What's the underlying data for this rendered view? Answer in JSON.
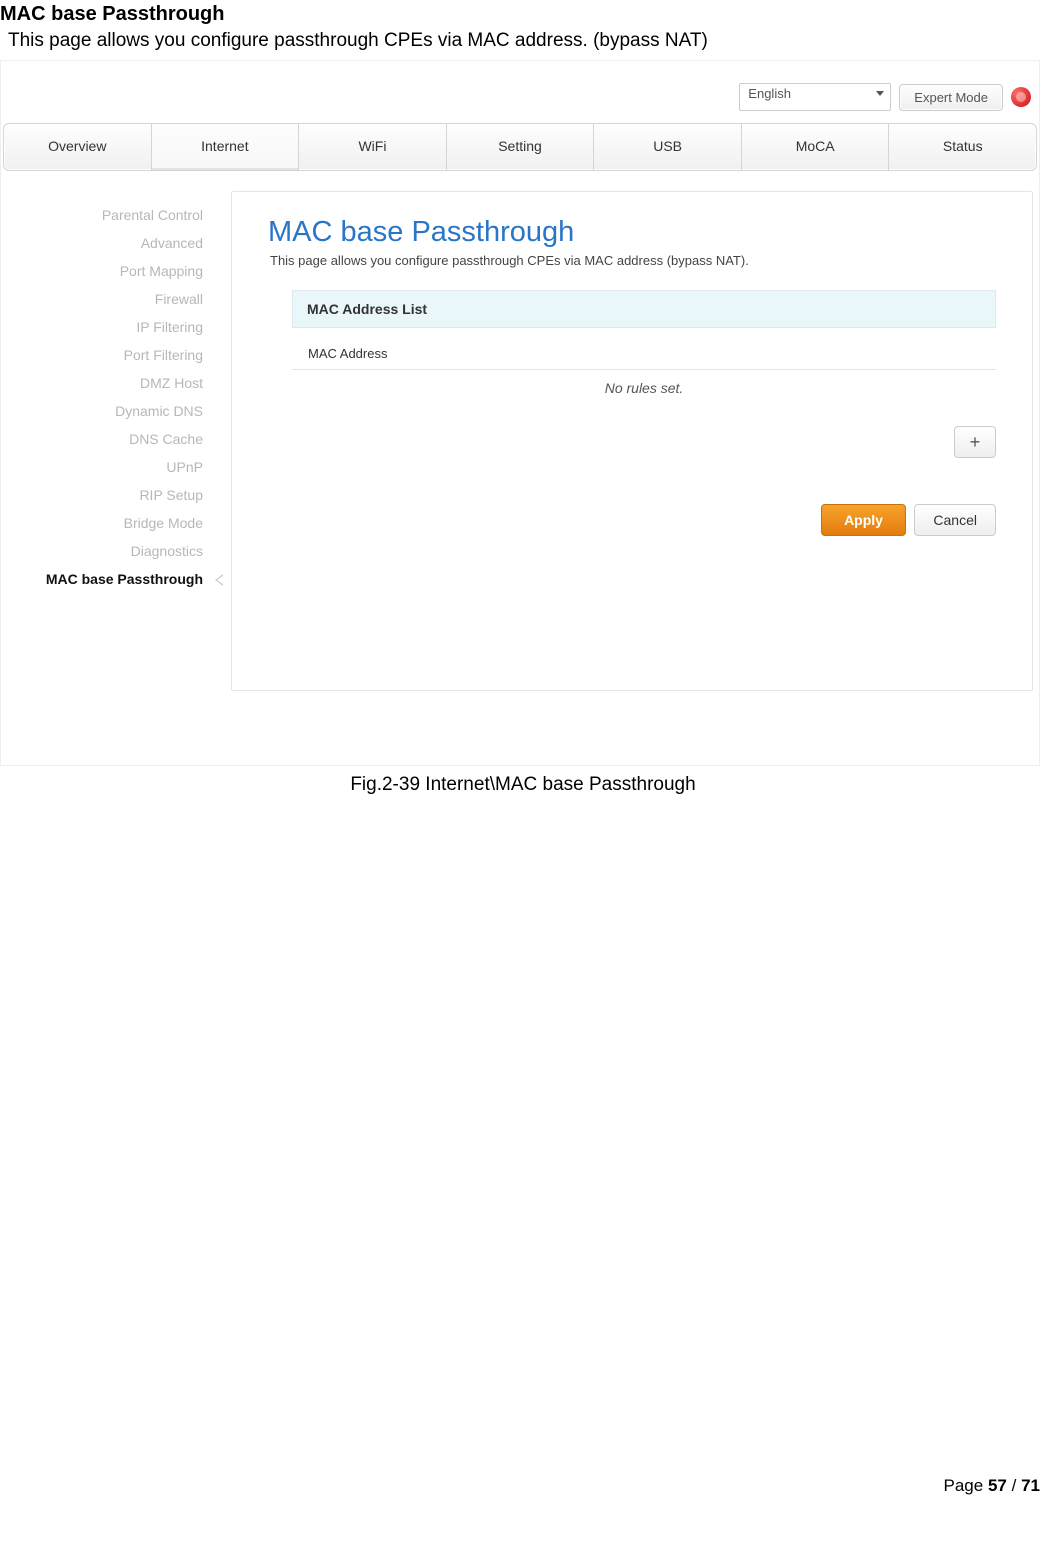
{
  "doc": {
    "heading": "MAC base Passthrough",
    "intro": "This page allows you configure passthrough CPEs via MAC address. (bypass NAT)",
    "caption": "Fig.2-39 Internet\\MAC base Passthrough",
    "page_label_prefix": "Page",
    "page_current": "57",
    "page_sep": "/",
    "page_total": "71"
  },
  "topbar": {
    "language": "English",
    "expert": "Expert Mode"
  },
  "tabs": [
    "Overview",
    "Internet",
    "WiFi",
    "Setting",
    "USB",
    "MoCA",
    "Status"
  ],
  "active_tab_index": 1,
  "sidebar": {
    "items": [
      "Parental Control",
      "Advanced",
      "Port Mapping",
      "Firewall",
      "IP Filtering",
      "Port Filtering",
      "DMZ Host",
      "Dynamic DNS",
      "DNS Cache",
      "UPnP",
      "RIP Setup",
      "Bridge Mode",
      "Diagnostics",
      "MAC base Passthrough"
    ],
    "active_index": 13
  },
  "panel": {
    "title": "MAC base Passthrough",
    "subtitle": "This page allows you configure passthrough CPEs via MAC address (bypass NAT).",
    "list_header": "MAC Address List",
    "column": "MAC Address",
    "empty": "No rules set.",
    "add_symbol": "+",
    "apply": "Apply",
    "cancel": "Cancel"
  }
}
